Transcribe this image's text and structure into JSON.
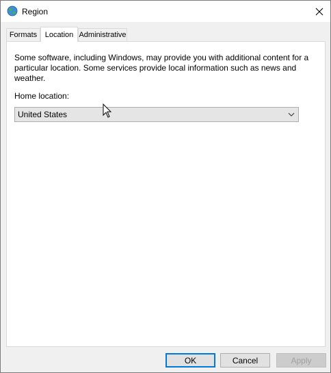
{
  "window": {
    "title": "Region"
  },
  "tabs": [
    {
      "label": "Formats"
    },
    {
      "label": "Location"
    },
    {
      "label": "Administrative"
    }
  ],
  "location": {
    "description": "Some software, including Windows, may provide you with additional content for a particular location. Some services provide local information such as news and weather.",
    "home_label": "Home location:",
    "home_value": "United States"
  },
  "buttons": {
    "ok": "OK",
    "cancel": "Cancel",
    "apply": "Apply"
  },
  "icons": {
    "app": "globe-icon",
    "close": "close-icon",
    "dropdown": "chevron-down-icon",
    "cursor": "mouse-pointer-icon"
  },
  "colors": {
    "accent": "#0078d7",
    "panel": "#ffffff",
    "window_bg": "#f0f0f0"
  }
}
